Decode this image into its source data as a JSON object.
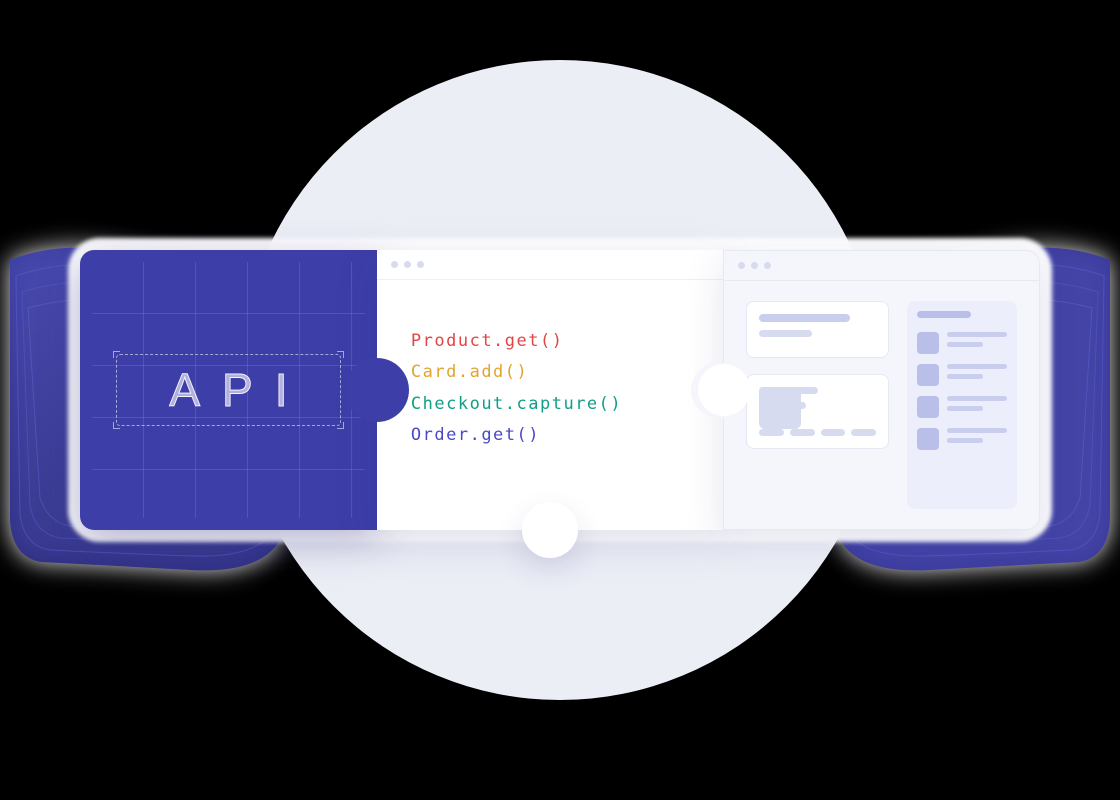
{
  "api_label": "API",
  "code_lines": [
    {
      "text": "Product.get()",
      "color": "c-red"
    },
    {
      "text": "Card.add()",
      "color": "c-amber"
    },
    {
      "text": "Checkout.capture()",
      "color": "c-teal"
    },
    {
      "text": "Order.get()",
      "color": "c-indigo"
    }
  ]
}
